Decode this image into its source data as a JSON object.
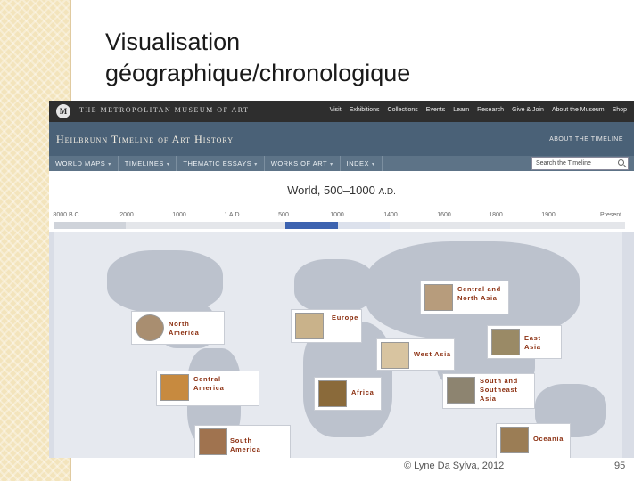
{
  "slide": {
    "title_line1": "Visualisation",
    "title_line2": "géographique/chronologique",
    "footer": "© Lyne Da Sylva, 2012",
    "page_number": "95"
  },
  "site_header": {
    "logo_letter": "M",
    "museum_name": "THE METROPOLITAN MUSEUM OF ART",
    "nav": [
      "Visit",
      "Exhibitions",
      "Collections",
      "Events",
      "Learn",
      "Research",
      "Give & Join",
      "About the Museum",
      "Shop"
    ]
  },
  "timeline_header": {
    "title": "Heilbrunn Timeline of Art History",
    "about_link": "ABOUT THE TIMELINE"
  },
  "menu": {
    "items": [
      "WORLD MAPS",
      "TIMELINES",
      "THEMATIC ESSAYS",
      "WORKS OF ART",
      "INDEX"
    ],
    "search_placeholder": "Search the Timeline"
  },
  "period": {
    "title": "World, 500–1000",
    "era": "A.D."
  },
  "timeline_ticks": [
    "8000 B.C.",
    "2000",
    "1000",
    "1 A.D.",
    "500",
    "1000",
    "1400",
    "1600",
    "1800",
    "1900",
    "Present"
  ],
  "regions": [
    {
      "name_line1": "Central and",
      "name_line2": "North Asia"
    },
    {
      "name_line1": "North",
      "name_line2": "America"
    },
    {
      "name_line1": "Europe",
      "name_line2": ""
    },
    {
      "name_line1": "East",
      "name_line2": "Asia"
    },
    {
      "name_line1": "West Asia",
      "name_line2": ""
    },
    {
      "name_line1": "Central",
      "name_line2": "America"
    },
    {
      "name_line1": "Africa",
      "name_line2": ""
    },
    {
      "name_line1": "South and",
      "name_line2": "Southeast",
      "name_line3": "Asia"
    },
    {
      "name_line1": "South",
      "name_line2": "America"
    },
    {
      "name_line1": "Oceania",
      "name_line2": ""
    }
  ],
  "colors": {
    "slide_accent": "#f3e4bc",
    "met_bar": "#2e2e2e",
    "timeline_bar": "#4a6177",
    "menu_bar": "#5d7387",
    "timeline_selected": "#3d63b0",
    "region_label": "#8b2e0f"
  }
}
